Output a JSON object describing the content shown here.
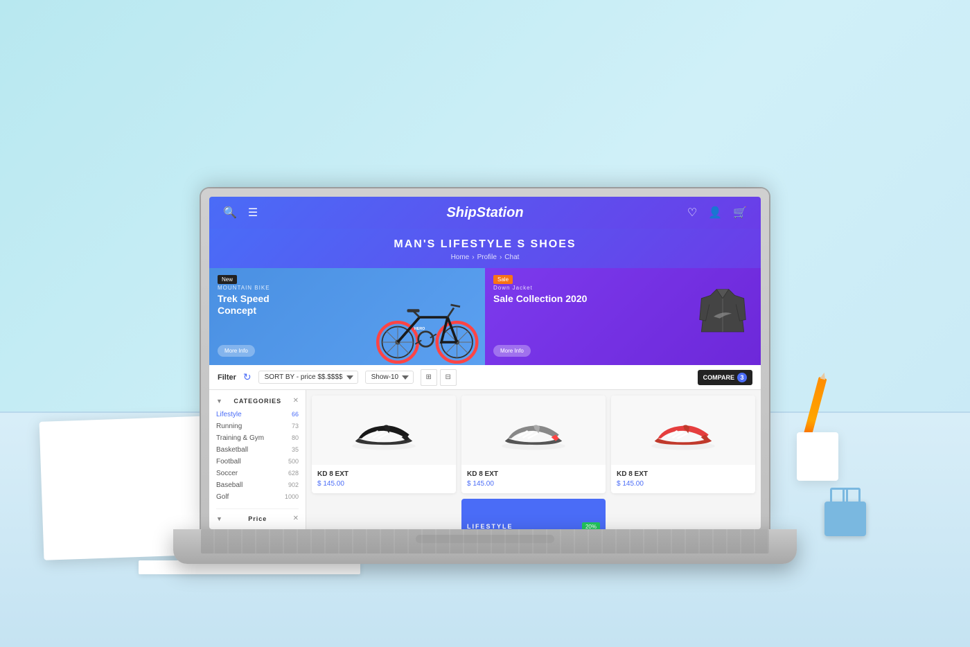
{
  "scene": {
    "background": "light blue"
  },
  "nav": {
    "brand": "ShipStation",
    "search_icon": "🔍",
    "menu_icon": "☰",
    "wishlist_icon": "♡",
    "account_icon": "👤",
    "cart_icon": "🛒"
  },
  "hero": {
    "title": "MAN'S LIFESTYLE S SHOES",
    "breadcrumb": [
      "Home",
      "Profile",
      "Chat"
    ]
  },
  "banners": {
    "left": {
      "badge": "New",
      "category": "MOUNTAIN BIKE",
      "title": "Trek Speed Concept",
      "button": "More Info"
    },
    "right": {
      "badge": "Sale",
      "category": "Down Jacket",
      "title": "Sale Collection 2020",
      "button": "More Info"
    }
  },
  "toolbar": {
    "filter_label": "Filter",
    "sort_label": "SORT BY - price $$.$$$$",
    "show_label": "Show-10",
    "compare_label": "COMPARE",
    "compare_count": "3"
  },
  "sidebar": {
    "categories_label": "CATEGORIES",
    "items": [
      {
        "name": "Lifestyle",
        "count": "66",
        "active": true
      },
      {
        "name": "Running",
        "count": "73"
      },
      {
        "name": "Training & Gym",
        "count": "80"
      },
      {
        "name": "Basketball",
        "count": "35"
      },
      {
        "name": "Football",
        "count": "500"
      },
      {
        "name": "Soccer",
        "count": "628"
      },
      {
        "name": "Baseball",
        "count": "902"
      },
      {
        "name": "Golf",
        "count": "1000"
      }
    ],
    "price_label": "Price"
  },
  "products": [
    {
      "id": 1,
      "name": "KD 8 EXT",
      "price": "$ 145.00",
      "color": "black"
    },
    {
      "id": 2,
      "name": "KD 8 EXT",
      "price": "$ 145.00",
      "color": "gray"
    },
    {
      "id": 3,
      "name": "KD 8 EXT",
      "price": "$ 145.00",
      "color": "red"
    }
  ],
  "lifestyle_card": {
    "label": "LIFESTYLE",
    "badge": "20%"
  }
}
